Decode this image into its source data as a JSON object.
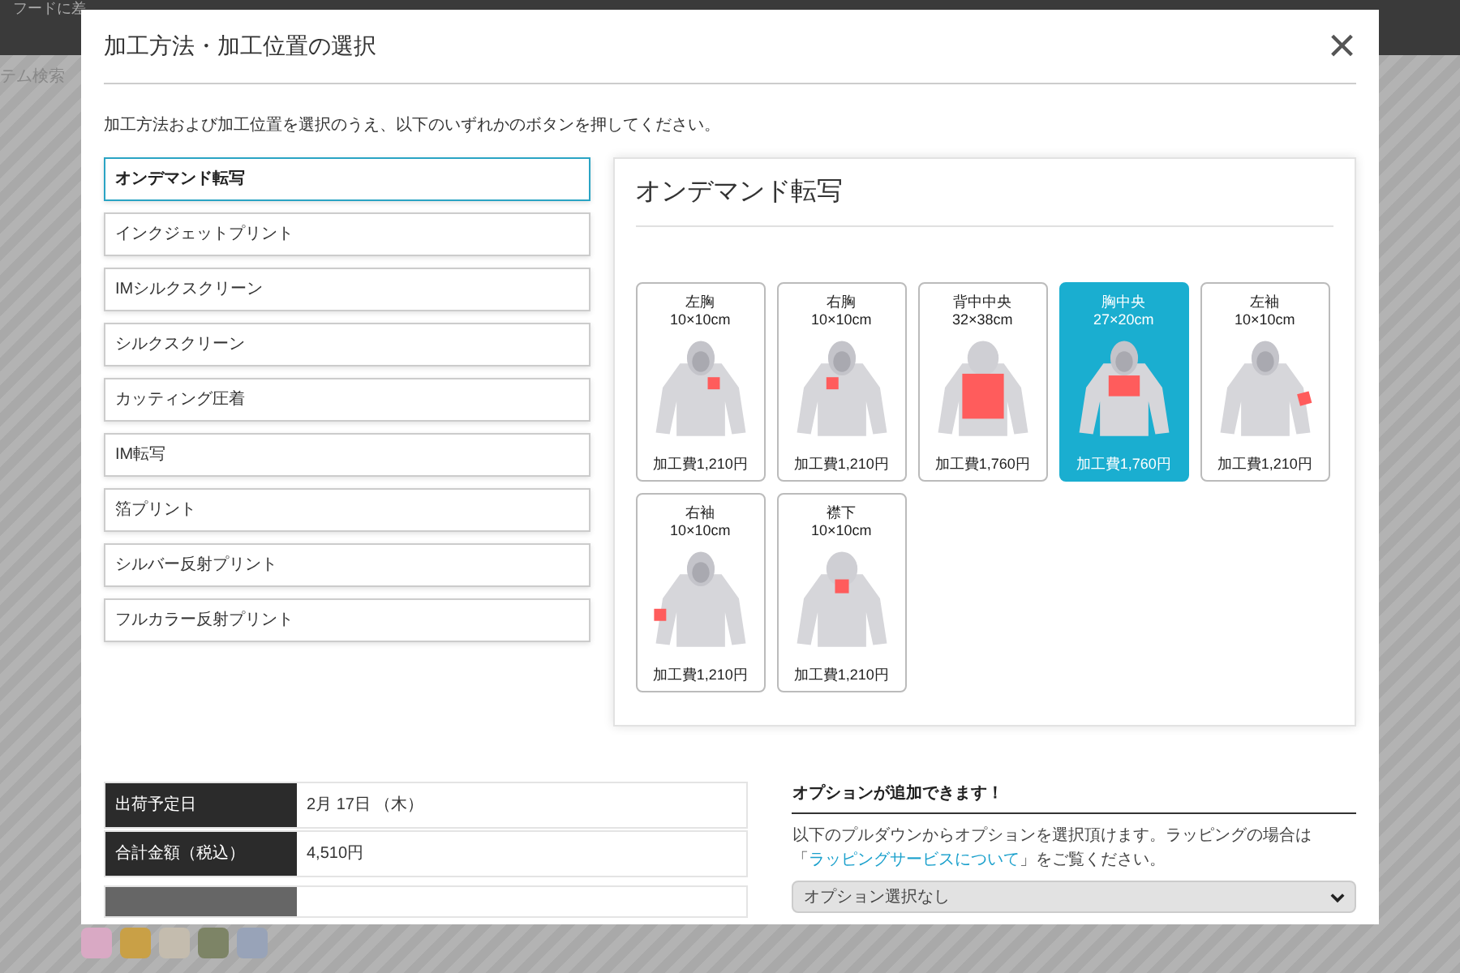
{
  "background": {
    "banner": "フードに差",
    "side_text": "テム検索",
    "swatches": [
      {
        "color": "#d9a9c4"
      },
      {
        "color": "#c9a046"
      },
      {
        "color": "#c4bcae"
      },
      {
        "color": "#7d8466"
      },
      {
        "color": "#98a3b8"
      }
    ]
  },
  "dialog": {
    "title": "加工方法・加工位置の選択",
    "close": "×",
    "instruction": "加工方法および加工位置を選択のうえ、以下のいずれかのボタンを押してください。",
    "methods": [
      {
        "label": "オンデマンド転写",
        "selected": true
      },
      {
        "label": "インクジェットプリント",
        "selected": false
      },
      {
        "label": "IMシルクスクリーン",
        "selected": false
      },
      {
        "label": "シルクスクリーン",
        "selected": false
      },
      {
        "label": "カッティング圧着",
        "selected": false
      },
      {
        "label": "IM転写",
        "selected": false
      },
      {
        "label": "箔プリント",
        "selected": false
      },
      {
        "label": "シルバー反射プリント",
        "selected": false
      },
      {
        "label": "フルカラー反射プリント",
        "selected": false
      }
    ],
    "panel_title": "オンデマンド転写",
    "positions": [
      {
        "name": "左胸",
        "size": "10×10cm",
        "price": "加工費1,210円",
        "kind": "left-chest",
        "selected": false
      },
      {
        "name": "右胸",
        "size": "10×10cm",
        "price": "加工費1,210円",
        "kind": "right-chest",
        "selected": false
      },
      {
        "name": "背中中央",
        "size": "32×38cm",
        "price": "加工費1,760円",
        "kind": "back-center",
        "selected": false
      },
      {
        "name": "胸中央",
        "size": "27×20cm",
        "price": "加工費1,760円",
        "kind": "center-chest",
        "selected": true
      },
      {
        "name": "左袖",
        "size": "10×10cm",
        "price": "加工費1,210円",
        "kind": "left-sleeve",
        "selected": false
      },
      {
        "name": "右袖",
        "size": "10×10cm",
        "price": "加工費1,210円",
        "kind": "right-sleeve",
        "selected": false
      },
      {
        "name": "襟下",
        "size": "10×10cm",
        "price": "加工費1,210円",
        "kind": "nape",
        "selected": false
      }
    ],
    "summary": [
      {
        "label": "出荷予定日",
        "value": "2月 17日 （木）"
      },
      {
        "label": "合計金額（税込）",
        "value": "4,510円"
      }
    ],
    "options": {
      "heading": "オプションが追加できます！",
      "text_before": "以下のプルダウンからオプションを選択頂けます。ラッピングの場合は「",
      "link": "ラッピングサービスについて",
      "text_after": "」をご覧ください。",
      "select_value": "オプション選択なし"
    }
  }
}
